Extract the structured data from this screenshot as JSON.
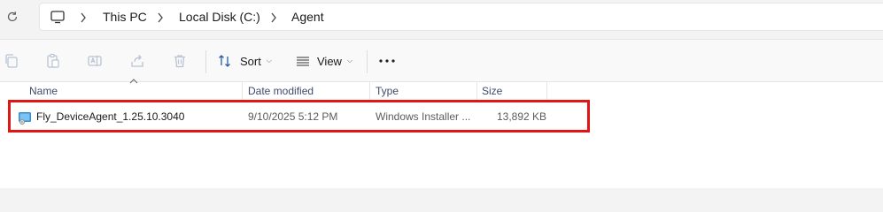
{
  "address": {
    "breadcrumbs": [
      "This PC",
      "Local Disk (C:)",
      "Agent"
    ]
  },
  "toolbar": {
    "sort_label": "Sort",
    "view_label": "View"
  },
  "columns": {
    "name": "Name",
    "date": "Date modified",
    "type": "Type",
    "size": "Size"
  },
  "files": [
    {
      "name": "Fly_DeviceAgent_1.25.10.3040",
      "date": "9/10/2025 5:12 PM",
      "type": "Windows Installer ...",
      "size": "13,892 KB"
    }
  ],
  "colors": {
    "highlight": "#e01515",
    "accent": "#0067c0"
  }
}
